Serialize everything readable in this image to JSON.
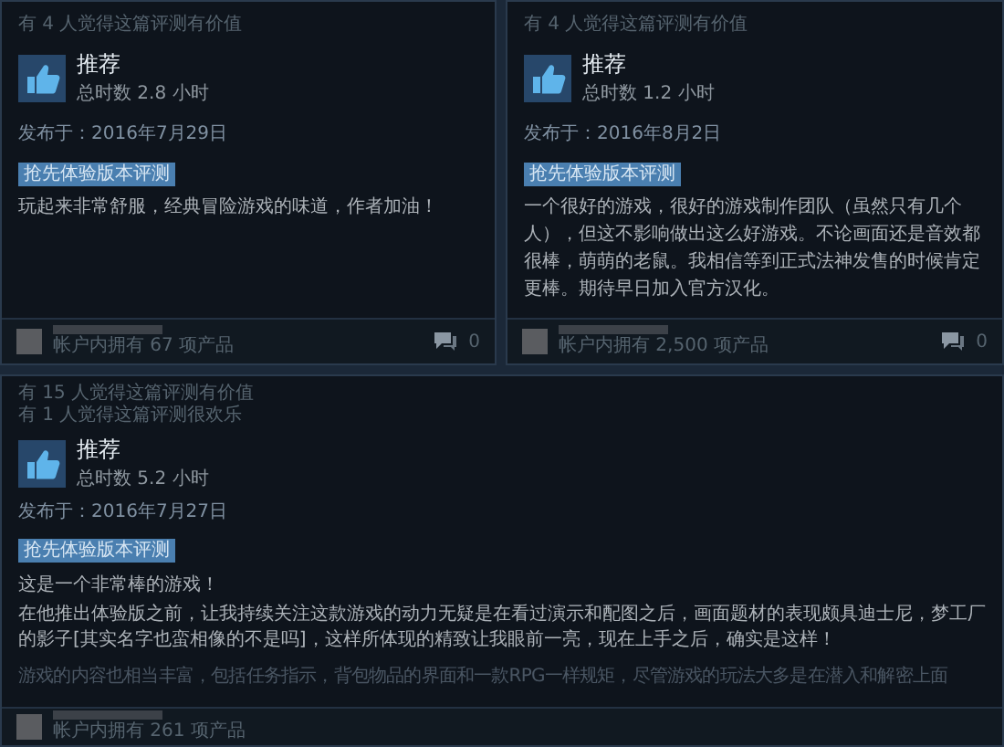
{
  "reviews": [
    {
      "helpful": [
        "有 4 人觉得这篇评测有价值"
      ],
      "title": "推荐",
      "hours": "总时数 2.8 小时",
      "posted": "发布于：2016年7月29日",
      "tag": "抢先体验版本评测",
      "paragraphs": [
        {
          "kind": "text",
          "text": "玩起来非常舒服，经典冒险游戏的味道，作者加油！"
        }
      ],
      "products": "帐户内拥有 67 项产品",
      "comments": "0"
    },
    {
      "helpful": [
        "有 4 人觉得这篇评测有价值"
      ],
      "title": "推荐",
      "hours": "总时数 1.2 小时",
      "posted": "发布于：2016年8月2日",
      "tag": "抢先体验版本评测",
      "paragraphs": [
        {
          "kind": "text",
          "text": "一个很好的游戏，很好的游戏制作团队（虽然只有几个人），但这不影响做出这么好游戏。不论画面还是音效都很棒，萌萌的老鼠。我相信等到正式法神发售的时候肯定更棒。期待早日加入官方汉化。"
        }
      ],
      "products": "帐户内拥有 2,500 项产品",
      "comments": "0"
    },
    {
      "helpful": [
        "有 15 人觉得这篇评测有价值",
        "有 1 人觉得这篇评测很欢乐"
      ],
      "title": "推荐",
      "hours": "总时数 5.2 小时",
      "posted": "发布于：2016年7月27日",
      "tag": "抢先体验版本评测",
      "paragraphs": [
        {
          "kind": "text",
          "text": "这是一个非常棒的游戏！"
        },
        {
          "kind": "text",
          "text": "在他推出体验版之前，让我持续关注这款游戏的动力无疑是在看过演示和配图之后，画面题材的表现颇具迪士尼，梦工厂的影子[其实名字也蛮相像的不是吗]，这样所体现的精致让我眼前一亮，现在上手之后，确实是这样！"
        },
        {
          "kind": "faded",
          "text": "游戏的内容也相当丰富，包括任务指示，背包物品的界面和一款RPG一样规矩，尽管游戏的玩法大多是在潜入和解密上面"
        }
      ],
      "products": "帐户内拥有 261 项产品"
    }
  ]
}
